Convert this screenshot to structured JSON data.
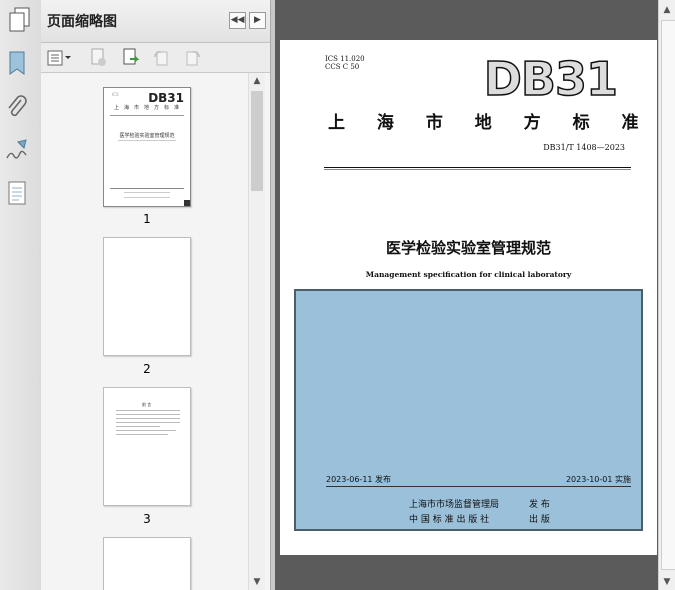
{
  "panel": {
    "title": "页面缩略图",
    "prev_label": "◀◀",
    "next_label": "▶"
  },
  "icons": {
    "left_strip": [
      "pages-icon",
      "bookmark-icon",
      "attachment-icon",
      "signature-icon",
      "document-properties-icon"
    ],
    "toolbar": [
      "options-menu-icon",
      "delete-page-icon",
      "insert-page-icon",
      "rotate-left-icon",
      "rotate-right-icon"
    ]
  },
  "thumbnails": [
    {
      "label": "1"
    },
    {
      "label": "2"
    },
    {
      "label": "3"
    }
  ],
  "document": {
    "ics": "ICS 11.020",
    "ccs": "CCS C 50",
    "code": "DB31",
    "org_title": "上 海 市 地 方 标 准",
    "std_number": "DB31/T 1408—2023",
    "title_cn": "医学检验实验室管理规范",
    "title_en": "Management specification for clinical laboratory",
    "publish_date": "2023-06-11 发布",
    "implement_date": "2023-10-01 实施",
    "issuer1": "上海市市场监督管理局",
    "issuer1_action": "发 布",
    "issuer2": "中 国 标 准 出 版 社",
    "issuer2_action": "出 版",
    "cover_color": "#9bc0d9",
    "cover_border": "#4b5f6b"
  }
}
